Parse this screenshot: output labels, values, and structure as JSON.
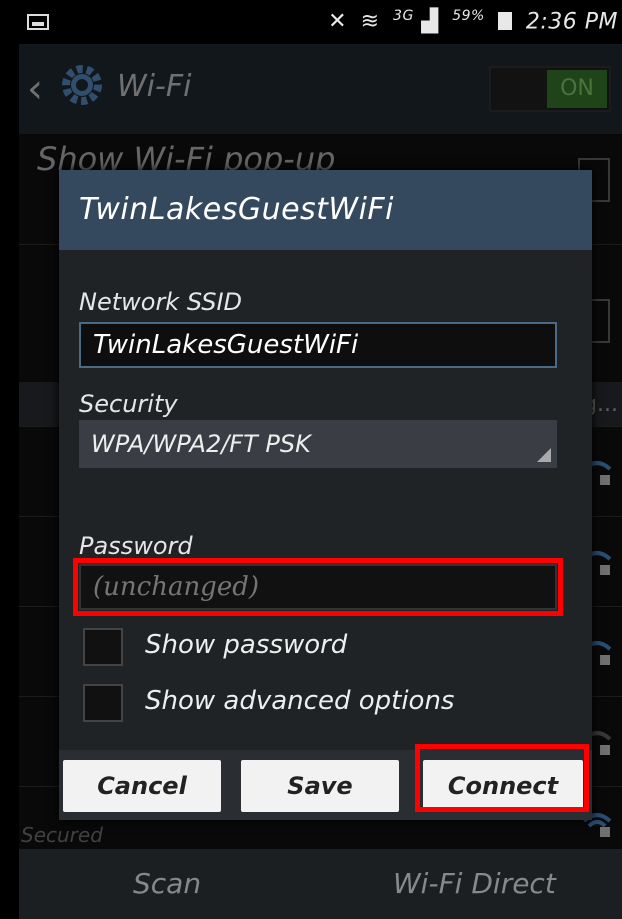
{
  "status_bar": {
    "network_type": "3G",
    "battery_percent": "59%",
    "time": "2:36 PM"
  },
  "header": {
    "title": "Wi-Fi",
    "toggle_label": "ON"
  },
  "background": {
    "setting_show_popup": "Show Wi-Fi pop-up",
    "list_tail_text": "g...",
    "last_network_subtitle": "Secured",
    "bottom_bar": {
      "scan": "Scan",
      "wifi_direct": "Wi-Fi Direct"
    }
  },
  "dialog": {
    "title": "TwinLakesGuestWiFi",
    "ssid_label": "Network SSID",
    "ssid_value": "TwinLakesGuestWiFi",
    "security_label": "Security",
    "security_value": "WPA/WPA2/FT PSK",
    "password_label": "Password",
    "password_placeholder": "(unchanged)",
    "show_password_label": "Show password",
    "show_advanced_label": "Show advanced options",
    "buttons": {
      "cancel": "Cancel",
      "save": "Save",
      "connect": "Connect"
    }
  },
  "colors": {
    "dialog_header": "#34495e",
    "highlight": "#ff0000",
    "toggle_on": "#3a7d2e"
  }
}
